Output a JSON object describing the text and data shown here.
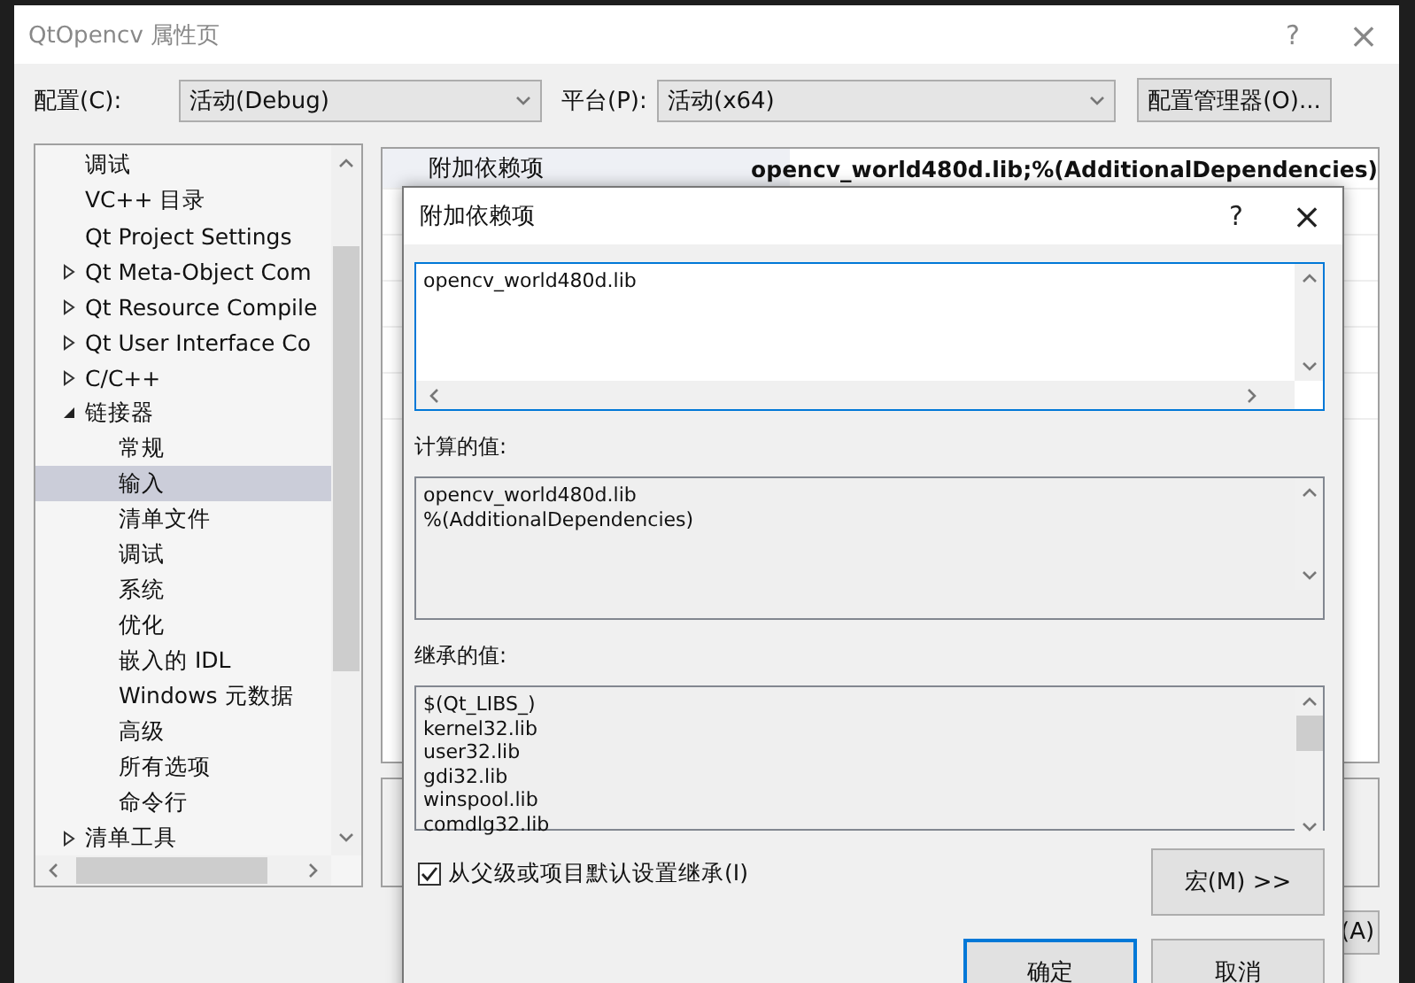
{
  "window": {
    "title": "QtOpencv 属性页",
    "help": "?",
    "close": "×"
  },
  "config": {
    "label": "配置(C):",
    "value": "活动(Debug)"
  },
  "platform": {
    "label": "平台(P):",
    "value": "活动(x64)"
  },
  "config_manager_button": "配置管理器(O)...",
  "tree": {
    "items": [
      {
        "label": "调试",
        "selected": false
      },
      {
        "label": "VC++ 目录",
        "selected": false
      },
      {
        "label": "Qt Project Settings",
        "selected": false
      },
      {
        "label": "Qt Meta-Object Com",
        "selected": false,
        "expanded": false
      },
      {
        "label": "Qt Resource Compile",
        "selected": false,
        "expanded": false
      },
      {
        "label": "Qt User Interface Co",
        "selected": false,
        "expanded": false
      },
      {
        "label": "C/C++",
        "selected": false,
        "expanded": false
      },
      {
        "label": "链接器",
        "selected": false,
        "expanded": true,
        "children": [
          {
            "label": "常规",
            "selected": false
          },
          {
            "label": "输入",
            "selected": true
          },
          {
            "label": "清单文件",
            "selected": false
          },
          {
            "label": "调试",
            "selected": false
          },
          {
            "label": "系统",
            "selected": false
          },
          {
            "label": "优化",
            "selected": false
          },
          {
            "label": "嵌入的 IDL",
            "selected": false
          },
          {
            "label": "Windows 元数据",
            "selected": false
          },
          {
            "label": "高级",
            "selected": false
          },
          {
            "label": "所有选项",
            "selected": false
          },
          {
            "label": "命令行",
            "selected": false
          }
        ]
      },
      {
        "label": "清单工具",
        "selected": false,
        "expanded": false
      }
    ]
  },
  "property_grid": {
    "rows": [
      {
        "name": "附加依赖项",
        "value": "opencv_world480d.lib;%(AdditionalDependencies)"
      }
    ]
  },
  "apply_button": "(A)",
  "dialog": {
    "title": "附加依赖项",
    "help": "?",
    "close": "×",
    "edit_value": "opencv_world480d.lib",
    "computed_label": "计算的值:",
    "computed_values": [
      "opencv_world480d.lib",
      "%(AdditionalDependencies)"
    ],
    "inherited_label": "继承的值:",
    "inherited_values": [
      "$(Qt_LIBS_)",
      "kernel32.lib",
      "user32.lib",
      "gdi32.lib",
      "winspool.lib",
      "comdlg32.lib"
    ],
    "inherit_checkbox": {
      "label": "从父级或项目默认设置继承(I)",
      "checked": true
    },
    "macros_button": "宏(M) >>",
    "ok_button": "确定",
    "cancel_button": "取消"
  }
}
